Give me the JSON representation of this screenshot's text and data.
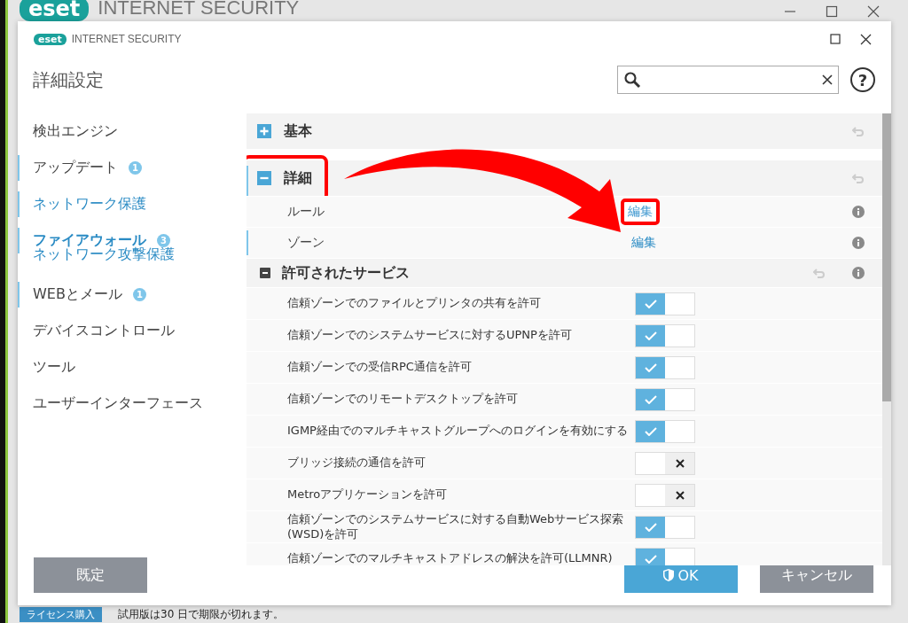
{
  "background_window": {
    "logo": "eset",
    "title": "INTERNET SECURITY",
    "license_button": "ライセンス購入",
    "trial_notice": "試用版は30 日で期限が切れます。"
  },
  "window": {
    "logo": "eset",
    "title": "INTERNET SECURITY"
  },
  "page_title": "詳細設定",
  "help": "?",
  "sidebar": {
    "items": [
      {
        "label": "検出エンジン",
        "changed": false,
        "active": false,
        "selected": false
      },
      {
        "label": "アップデート",
        "badge": "1",
        "changed": true,
        "active": false,
        "selected": false
      },
      {
        "label": "ネットワーク保護",
        "changed": true,
        "active": true,
        "selected": false
      },
      {
        "label": "ファイアウォール",
        "badge": "3",
        "changed": true,
        "active": true,
        "selected": true
      },
      {
        "label": "ネットワーク攻撃保護",
        "changed": false,
        "active": true,
        "selected": false
      },
      {
        "label": "WEBとメール",
        "badge": "1",
        "changed": true,
        "active": false,
        "selected": false
      },
      {
        "label": "デバイスコントロール",
        "changed": false,
        "active": false,
        "selected": false
      },
      {
        "label": "ツール",
        "changed": false,
        "active": false,
        "selected": false
      },
      {
        "label": "ユーザーインターフェース",
        "changed": false,
        "active": false,
        "selected": false
      }
    ]
  },
  "sections": [
    {
      "title": "基本",
      "expanded": false,
      "changed": false,
      "highlighted": false
    },
    {
      "title": "詳細",
      "expanded": true,
      "changed": true,
      "highlighted": true,
      "rows": [
        {
          "kind": "link",
          "label": "ルール",
          "link": "編集",
          "changed": false,
          "highlighted": true
        },
        {
          "kind": "link",
          "label": "ゾーン",
          "link": "編集",
          "changed": true,
          "highlighted": false
        },
        {
          "kind": "group",
          "label": "許可されたサービス",
          "expanded": true
        },
        {
          "kind": "toggle",
          "label": "信頼ゾーンでのファイルとプリンタの共有を許可",
          "checked": true
        },
        {
          "kind": "toggle",
          "label": "信頼ゾーンでのシステムサービスに対するUPNPを許可",
          "checked": true
        },
        {
          "kind": "toggle",
          "label": "信頼ゾーンでの受信RPC通信を許可",
          "checked": true
        },
        {
          "kind": "toggle",
          "label": "信頼ゾーンでのリモートデスクトップを許可",
          "checked": true
        },
        {
          "kind": "toggle",
          "label": "IGMP経由でのマルチキャストグループへのログインを有効にする",
          "checked": true
        },
        {
          "kind": "toggle",
          "label": "ブリッジ接続の通信を許可",
          "checked": false
        },
        {
          "kind": "toggle",
          "label": "Metroアプリケーションを許可",
          "checked": false
        },
        {
          "kind": "toggle",
          "label": "信頼ゾーンでのシステムサービスに対する自動Webサービス探索(WSD)を許可",
          "checked": true
        },
        {
          "kind": "toggle",
          "label": "信頼ゾーンでのマルチキャストアドレスの解決を許可(LLMNR)",
          "checked": true
        }
      ]
    }
  ],
  "callout_arrow": true,
  "buttons": [
    {
      "label": "既定",
      "kind": "default"
    },
    {
      "label": "OK",
      "kind": "primary"
    },
    {
      "label": "キャンセル",
      "kind": "cancel"
    }
  ]
}
